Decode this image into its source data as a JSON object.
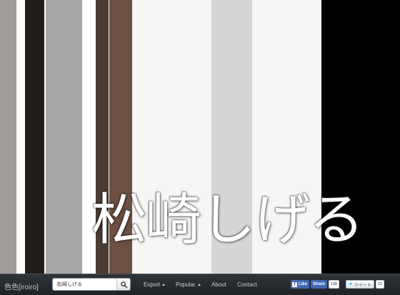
{
  "palette": {
    "title": "松崎しげる",
    "stripes": [
      {
        "color": "#a19b9a"
      },
      {
        "color": "#ffffff"
      },
      {
        "color": "#211c18"
      },
      {
        "color": "#ffffff"
      },
      {
        "color": "#a9a8a6"
      },
      {
        "color": "#ffffff"
      },
      {
        "color": "#4b3c33"
      },
      {
        "color": "#ffffff"
      },
      {
        "color": "#6d5043"
      },
      {
        "color": "#f7f6f4"
      },
      {
        "color": "#d6d6d6"
      },
      {
        "color": "#f7f6f4"
      },
      {
        "color": "#000000"
      }
    ]
  },
  "navbar": {
    "brand": "色色[iroiro]",
    "search": {
      "value": "松崎しげる",
      "placeholder": ""
    },
    "search_icon": "search-icon",
    "links": {
      "export": "Export",
      "popular": "Popular",
      "about": "About",
      "contact": "Contact"
    },
    "social": {
      "like_label": "Like",
      "share_label": "Share",
      "share_count": "138",
      "tweet_label": "ツイート",
      "tweet_count": "22"
    }
  }
}
